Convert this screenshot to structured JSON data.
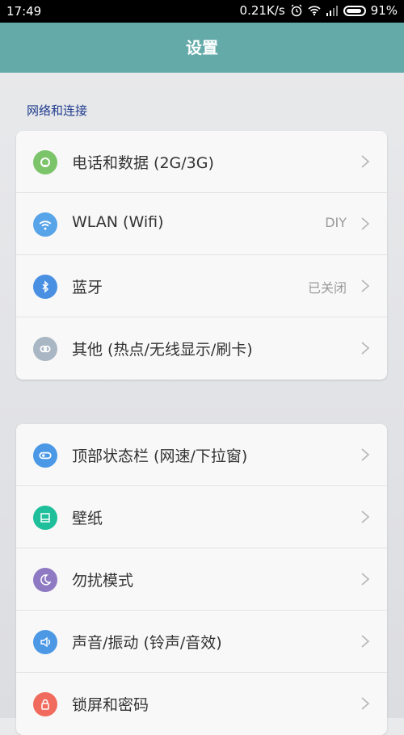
{
  "status_bar": {
    "time": "17:49",
    "network_speed": "0.21K/s",
    "battery": "91%"
  },
  "app_bar": {
    "title": "设置"
  },
  "section1": {
    "title": "网络和连接",
    "items": [
      {
        "label": "电话和数据 (2G/3G)",
        "value": "",
        "icon": "phone-data-icon",
        "color": "#7cc46a"
      },
      {
        "label": "WLAN (Wifi)",
        "value": "DIY",
        "icon": "wifi-icon",
        "color": "#58a4e9"
      },
      {
        "label": "蓝牙",
        "value": "已关闭",
        "icon": "bluetooth-icon",
        "color": "#4a90e2"
      },
      {
        "label": "其他 (热点/无线显示/刷卡)",
        "value": "",
        "icon": "link-icon",
        "color": "#a9b6c3"
      }
    ]
  },
  "section2": {
    "items": [
      {
        "label": "顶部状态栏 (网速/下拉窗)",
        "value": "",
        "icon": "status-bar-icon",
        "color": "#4b98e6"
      },
      {
        "label": "壁纸",
        "value": "",
        "icon": "wallpaper-icon",
        "color": "#1fbf9b"
      },
      {
        "label": "勿扰模式",
        "value": "",
        "icon": "moon-icon",
        "color": "#8e7ac3"
      },
      {
        "label": "声音/振动 (铃声/音效)",
        "value": "",
        "icon": "speaker-icon",
        "color": "#4d98e5"
      },
      {
        "label": "锁屏和密码",
        "value": "",
        "icon": "lock-icon",
        "color": "#f06b5e"
      }
    ]
  }
}
